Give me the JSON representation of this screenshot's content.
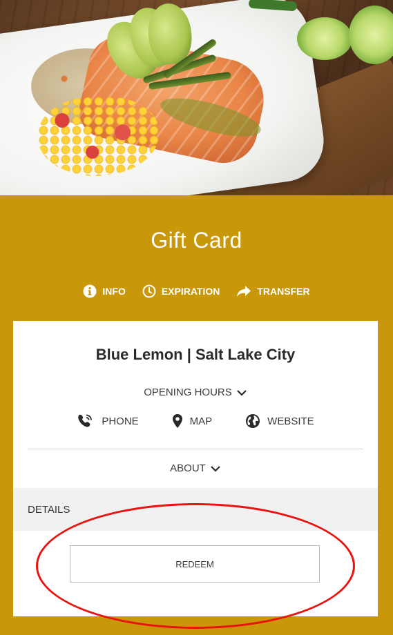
{
  "header": {
    "title": "Gift Card",
    "actions": [
      {
        "label": "INFO",
        "icon": "info-circle-icon"
      },
      {
        "label": "EXPIRATION",
        "icon": "clock-icon"
      },
      {
        "label": "TRANSFER",
        "icon": "share-arrow-icon"
      }
    ]
  },
  "card": {
    "venue_name": "Blue Lemon | Salt Lake City",
    "opening_hours_label": "OPENING HOURS",
    "contacts": [
      {
        "label": "PHONE",
        "icon": "phone-icon"
      },
      {
        "label": "MAP",
        "icon": "map-pin-icon"
      },
      {
        "label": "WEBSITE",
        "icon": "globe-icon"
      }
    ],
    "about_label": "ABOUT",
    "details_label": "DETAILS",
    "redeem_label": "REDEEM"
  },
  "colors": {
    "background": "#c9970a",
    "card": "#ffffff",
    "details_bar": "#f2f1f1",
    "highlight": "#e8120e"
  }
}
